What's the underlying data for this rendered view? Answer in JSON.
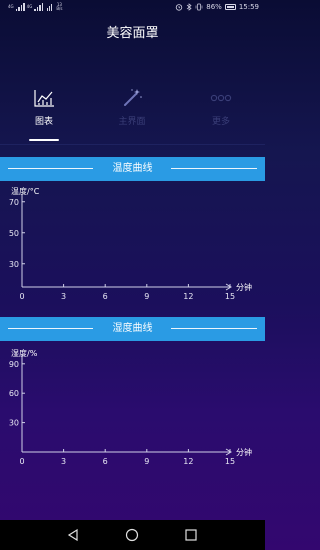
{
  "status_bar": {
    "carrier_tags": [
      "4G",
      "4G"
    ],
    "net_speed_top": "13",
    "net_speed_bottom": "B/s",
    "battery_percent": "86%",
    "time": "15:59",
    "icons": [
      "alarm-icon",
      "bluetooth-icon",
      "vibrate-icon",
      "battery-icon"
    ]
  },
  "header": {
    "title": "美容面罩"
  },
  "tabs": [
    {
      "label": "图表",
      "icon": "chart-icon",
      "active": true
    },
    {
      "label": "主界面",
      "icon": "magic-wand-icon",
      "active": false
    },
    {
      "label": "更多",
      "icon": "more-dots-icon",
      "active": false
    }
  ],
  "colors": {
    "banner": "#2a9be4",
    "tab_inactive": "#3a3e78",
    "axis": "#d0d0e8"
  },
  "charts": {
    "temperature": {
      "banner_title": "温度曲线"
    },
    "humidity": {
      "banner_title": "湿度曲线"
    }
  },
  "chart_data": [
    {
      "type": "line",
      "title": "温度曲线",
      "ylabel": "温度/°C",
      "xlabel": "分钟",
      "x_ticks": [
        0,
        3,
        6,
        9,
        12,
        15
      ],
      "y_ticks": [
        30,
        50,
        70
      ],
      "xlim": [
        0,
        15
      ],
      "ylim": [
        15,
        75
      ],
      "grid": false,
      "series": []
    },
    {
      "type": "line",
      "title": "湿度曲线",
      "ylabel": "湿度/%",
      "xlabel": "分钟",
      "x_ticks": [
        0,
        3,
        6,
        9,
        12,
        15
      ],
      "y_ticks": [
        30,
        60,
        90
      ],
      "xlim": [
        0,
        15
      ],
      "ylim": [
        0,
        100
      ],
      "grid": false,
      "series": []
    }
  ],
  "nav": {
    "buttons": [
      "back-icon",
      "home-icon",
      "recents-icon"
    ]
  }
}
